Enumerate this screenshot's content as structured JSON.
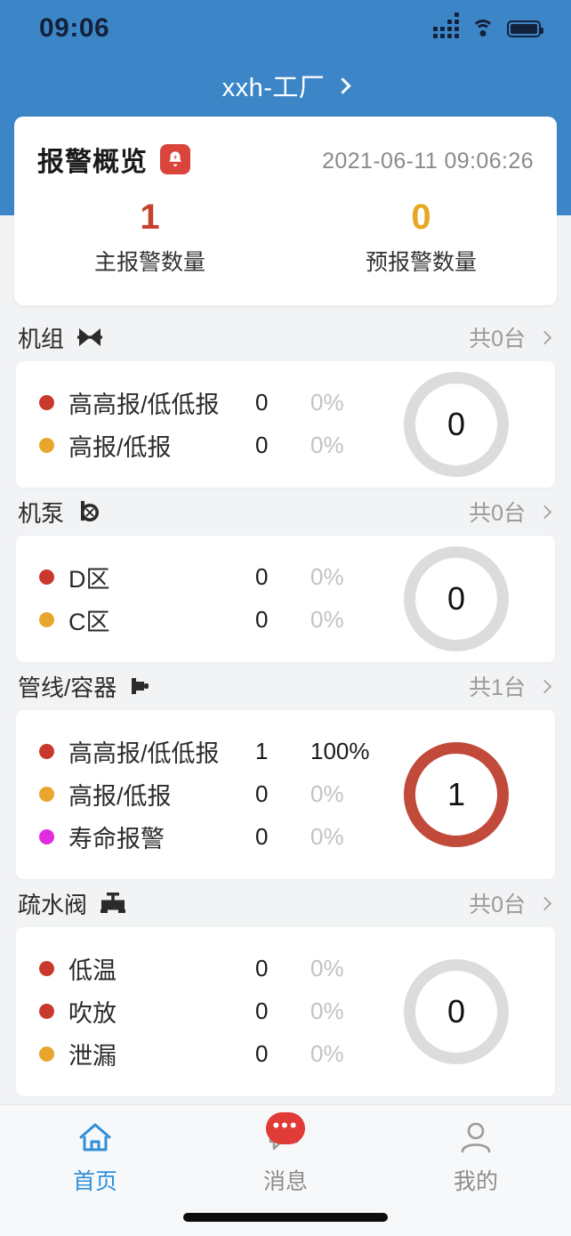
{
  "status_bar": {
    "time": "09:06",
    "signal_icon": "signal-bars-icon",
    "wifi_icon": "wifi-icon",
    "battery_icon": "battery-full-icon"
  },
  "header": {
    "site_name": "xxh-工厂",
    "chevron_icon": "chevron-right-icon",
    "background_color": "#3c86c8"
  },
  "overview": {
    "title": "报警概览",
    "bell_icon": "alarm-bell-icon",
    "timestamp": "2021-06-11 09:06:26",
    "stats": [
      {
        "value": "1",
        "label": "主报警数量",
        "color": "#c6422f"
      },
      {
        "value": "0",
        "label": "预报警数量",
        "color": "#e8a720"
      }
    ]
  },
  "sections": [
    {
      "name": "机组",
      "icon": "butterfly-valve-icon",
      "count_label": "共0台",
      "chevron_icon": "chevron-right-icon",
      "total": "0",
      "ring_color": "#dcdcdc",
      "rows": [
        {
          "label": "高高报/低低报",
          "count": "0",
          "pct": "0%",
          "color": "#c8382c",
          "pct_strong": false
        },
        {
          "label": "高报/低报",
          "count": "0",
          "pct": "0%",
          "color": "#e9a62c",
          "pct_strong": false
        }
      ]
    },
    {
      "name": "机泵",
      "icon": "pump-icon",
      "count_label": "共0台",
      "chevron_icon": "chevron-right-icon",
      "total": "0",
      "ring_color": "#dcdcdc",
      "rows": [
        {
          "label": "D区",
          "count": "0",
          "pct": "0%",
          "color": "#c8382c",
          "pct_strong": false
        },
        {
          "label": "C区",
          "count": "0",
          "pct": "0%",
          "color": "#e9a62c",
          "pct_strong": false
        }
      ]
    },
    {
      "name": "管线/容器",
      "icon": "pipe-flange-icon",
      "count_label": "共1台",
      "chevron_icon": "chevron-right-icon",
      "total": "1",
      "ring_color": "#c14a3a",
      "rows": [
        {
          "label": "高高报/低低报",
          "count": "1",
          "pct": "100%",
          "color": "#c8382c",
          "pct_strong": true
        },
        {
          "label": "高报/低报",
          "count": "0",
          "pct": "0%",
          "color": "#e9a62c",
          "pct_strong": false
        },
        {
          "label": "寿命报警",
          "count": "0",
          "pct": "0%",
          "color": "#e02ce0",
          "pct_strong": false
        }
      ]
    },
    {
      "name": "疏水阀",
      "icon": "gate-valve-icon",
      "count_label": "共0台",
      "chevron_icon": "chevron-right-icon",
      "total": "0",
      "ring_color": "#dcdcdc",
      "rows": [
        {
          "label": "低温",
          "count": "0",
          "pct": "0%",
          "color": "#c8382c",
          "pct_strong": false
        },
        {
          "label": "吹放",
          "count": "0",
          "pct": "0%",
          "color": "#c8382c",
          "pct_strong": false
        },
        {
          "label": "泄漏",
          "count": "0",
          "pct": "0%",
          "color": "#e9a62c",
          "pct_strong": false
        }
      ]
    }
  ],
  "tabbar": {
    "tabs": [
      {
        "label": "首页",
        "icon": "home-icon",
        "active": true,
        "badge": null
      },
      {
        "label": "消息",
        "icon": "message-icon",
        "active": false,
        "badge": "•••"
      },
      {
        "label": "我的",
        "icon": "person-icon",
        "active": false,
        "badge": null
      }
    ]
  }
}
